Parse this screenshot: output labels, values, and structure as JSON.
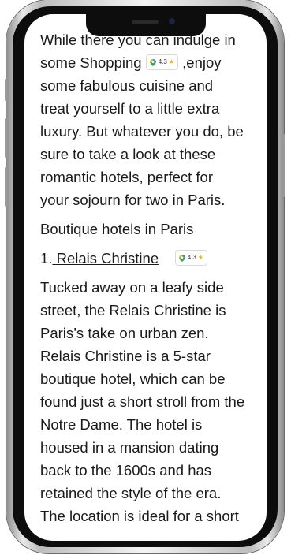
{
  "article": {
    "intro_line1": "While there you can indulge in",
    "intro_line2a": "some Shopping",
    "intro_line2b": ",enjoy",
    "intro_line3": "some fabulous cuisine and",
    "intro_line4": "treat yourself to a little extra",
    "intro_line5": "luxury. But whatever you do, be",
    "intro_line6": "sure to take a look at these",
    "intro_line7": "romantic hotels, perfect for",
    "intro_line8": "your sojourn for two in Paris.",
    "section_heading": "Boutique hotels in Paris",
    "item_number": "1.",
    "item_link": " Relais Christine",
    "desc_lines": [
      "Tucked away on a leafy side",
      "street, the Relais Christine is",
      "Paris’s take on urban zen.",
      "Relais Christine is a 5-star",
      "boutique hotel, which can be",
      "found just a short stroll from the",
      "Notre Dame. The hotel is",
      "housed in a mansion dating",
      "back to the 1600s and has",
      "retained the style of the era.",
      "The location is ideal for a short"
    ]
  },
  "badges": {
    "shopping_rating": "4.3",
    "hotel_rating": "4.3",
    "icon": "map-pin-icon",
    "star_icon": "star-icon"
  },
  "colors": {
    "star": "#f4b400",
    "pin_blue": "#4285f4",
    "pin_green": "#34a853",
    "pin_yellow": "#fbbc04",
    "pin_red": "#ea4335"
  }
}
